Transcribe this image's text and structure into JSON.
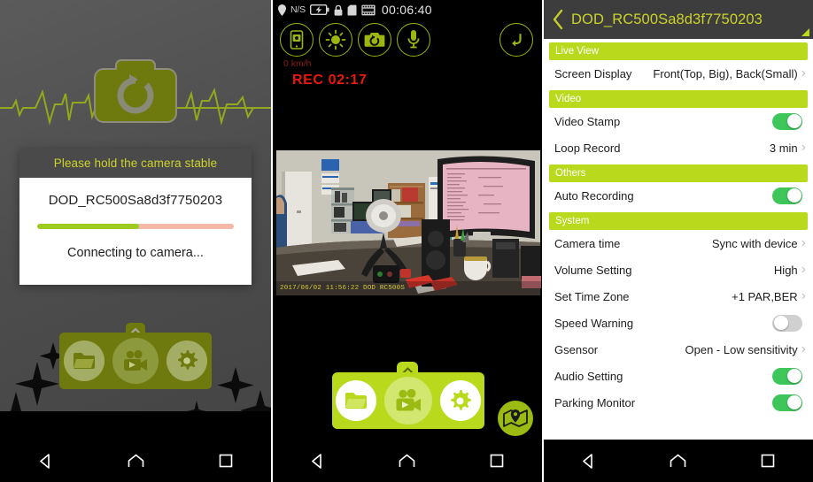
{
  "panel1": {
    "name": "connecting-screen",
    "logo_icon": "camera-sync-icon",
    "dialog": {
      "title": "Please hold the camera stable",
      "device_name": "DOD_RC500Sa8d3f7750203",
      "status": "Connecting to camera...",
      "progress_percent": 52,
      "progress_fill_color": "#9ccd1e",
      "progress_track_color": "#f3b9a8"
    },
    "bottom_bar": {
      "items": [
        {
          "icon": "folder-icon",
          "name": "file-browser-button"
        },
        {
          "icon": "video-camera-icon",
          "name": "live-view-button"
        },
        {
          "icon": "gear-icon",
          "name": "settings-button"
        }
      ],
      "handle_icon": "chevron-up-icon"
    }
  },
  "panel2": {
    "name": "live-view-screen",
    "statusbar": {
      "gps_icon": "location-pin-icon",
      "gps_label": "N/S",
      "battery_icon": "battery-charging-icon",
      "lock_icon": "lock-icon",
      "sdcard_icon": "sdcard-icon",
      "film_icon": "film-strip-icon",
      "time": "00:06:40"
    },
    "controls": [
      {
        "icon": "phone-snapshot-icon",
        "name": "save-to-phone-button"
      },
      {
        "icon": "brightness-sun-icon",
        "name": "brightness-button"
      },
      {
        "icon": "camera-switch-icon",
        "name": "switch-camera-button"
      },
      {
        "icon": "microphone-icon",
        "name": "microphone-button"
      }
    ],
    "return_button_icon": "return-arrow-icon",
    "speed": "0 km/h",
    "rec_status": "REC 02:17",
    "video_stamp": "2017/06/02 11:56:22 DOD RC500S",
    "bottom_bar": {
      "items": [
        {
          "icon": "folder-icon",
          "name": "file-browser-button"
        },
        {
          "icon": "video-camera-icon",
          "name": "live-view-button"
        },
        {
          "icon": "gear-icon",
          "name": "settings-button"
        }
      ],
      "handle_icon": "chevron-up-icon"
    },
    "gps_badge_icon": "map-pin-icon"
  },
  "panel3": {
    "name": "settings-screen",
    "header": {
      "back_icon": "chevron-left-icon",
      "title": "DOD_RC500Sa8d3f7750203"
    },
    "sections": [
      {
        "title": "Live View",
        "rows": [
          {
            "label": "Screen Display",
            "value": "Front(Top, Big), Back(Small)",
            "type": "chevron"
          }
        ]
      },
      {
        "title": "Video",
        "rows": [
          {
            "label": "Video Stamp",
            "value": "",
            "type": "toggle",
            "state": "on"
          },
          {
            "label": "Loop Record",
            "value": "3 min",
            "type": "chevron"
          }
        ]
      },
      {
        "title": "Others",
        "rows": [
          {
            "label": "Auto Recording",
            "value": "",
            "type": "toggle",
            "state": "on"
          }
        ]
      },
      {
        "title": "System",
        "rows": [
          {
            "label": "Camera time",
            "value": "Sync with device",
            "type": "chevron"
          },
          {
            "label": "Volume Setting",
            "value": "High",
            "type": "chevron"
          },
          {
            "label": "Set Time Zone",
            "value": "+1 PAR,BER",
            "type": "chevron"
          },
          {
            "label": "Speed Warning",
            "value": "",
            "type": "toggle",
            "state": "off"
          },
          {
            "label": "Gsensor",
            "value": "Open - Low sensitivity",
            "type": "chevron"
          },
          {
            "label": "Audio Setting",
            "value": "",
            "type": "toggle",
            "state": "on"
          },
          {
            "label": "Parking Monitor",
            "value": "",
            "type": "toggle",
            "state": "on"
          }
        ]
      }
    ]
  },
  "navbar": {
    "back_icon": "triangle-back-icon",
    "home_icon": "home-icon",
    "recents_icon": "square-recents-icon"
  },
  "colors": {
    "accent_green": "#b9d91d",
    "header_dark": "#3d3d3d",
    "toggle_on": "#3ec65a",
    "rec_red": "#e8190c"
  }
}
